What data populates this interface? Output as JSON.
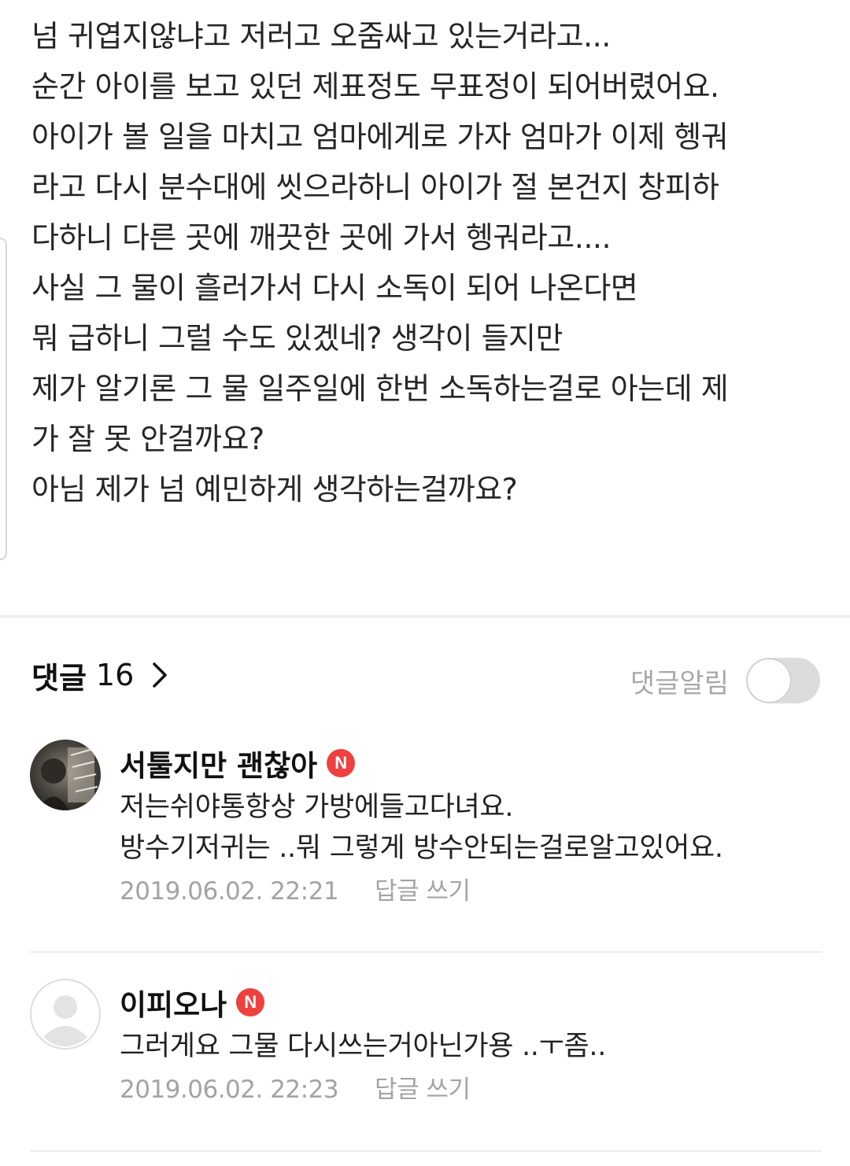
{
  "article": {
    "lines": [
      "넘 귀엽지않냐고 저러고 오줌싸고 있는거라고...",
      "순간 아이를 보고 있던 제표정도 무표정이 되어버렸어요.",
      "아이가 볼 일을 마치고 엄마에게로 가자 엄마가 이제 헹궈",
      "라고 다시 분수대에 씻으라하니 아이가 절 본건지 창피하",
      "다하니 다른 곳에 깨끗한 곳에 가서 헹궈라고....",
      "사실 그 물이 흘러가서 다시 소독이 되어 나온다면",
      "뭐 급하니 그럴 수도 있겠네? 생각이 들지만",
      "제가 알기론 그 물 일주일에 한번 소독하는걸로 아는데 제",
      "가 잘 못 안걸까요?",
      "아님 제가 넘 예민하게 생각하는걸까요?"
    ]
  },
  "comments_section": {
    "title": "댓글",
    "count": "16",
    "notify_label": "댓글알림",
    "notify_enabled": false,
    "reply_label": "답글 쓰기",
    "badge_letter": "N",
    "badge_color": "#ef4040",
    "items": [
      {
        "author": "서툴지만 괜찮아",
        "text_lines": [
          "저는쉬야통항상 가방에들고다녀요.",
          "방수기저귀는 ..뭐 그렇게 방수안되는걸로알고있어요."
        ],
        "date": "2019.06.02. 22:21",
        "avatar": "photo-avatar"
      },
      {
        "author": "이피오나",
        "text_lines": [
          "그러게요 그물 다시쓰는거아닌가용 ..ㅜ좀.."
        ],
        "date": "2019.06.02. 22:23",
        "avatar": "default-avatar"
      }
    ]
  }
}
